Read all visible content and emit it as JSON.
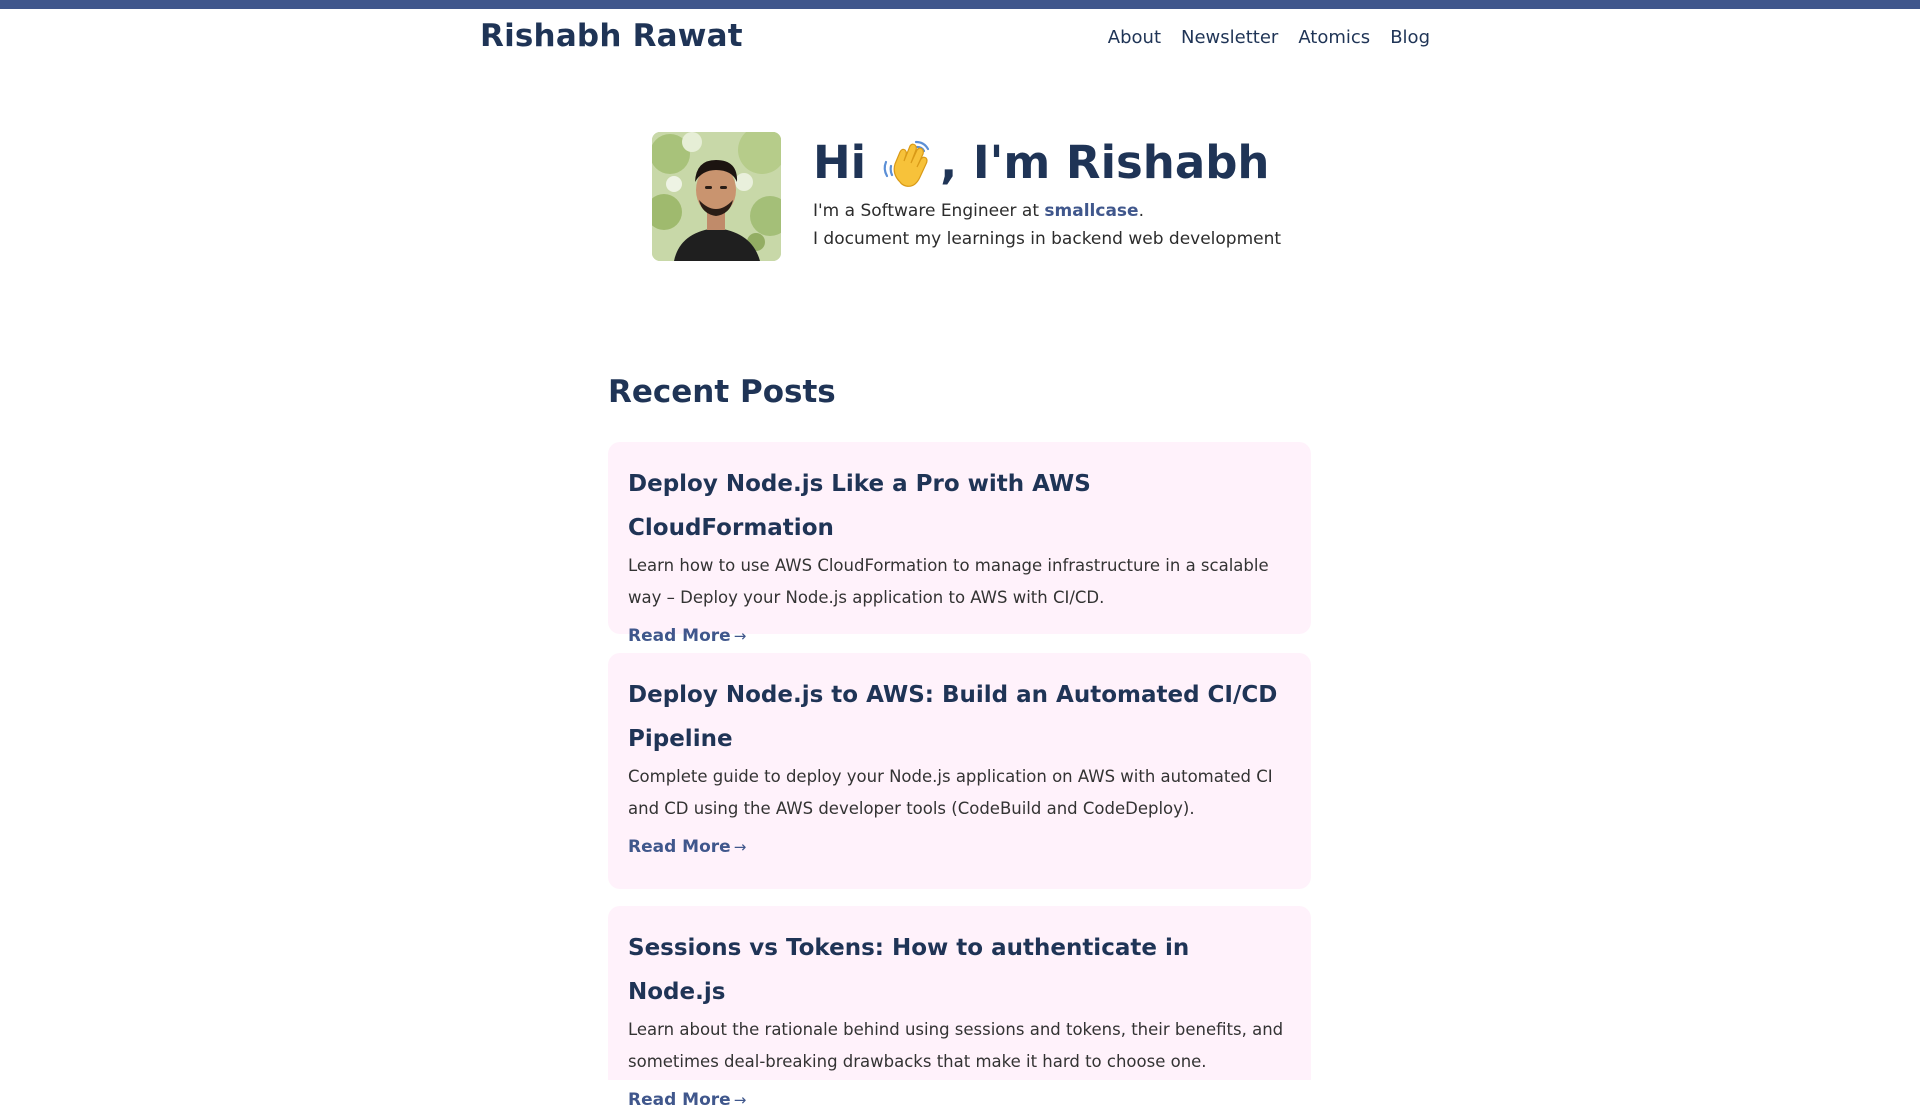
{
  "header": {
    "site_title": "Rishabh Rawat",
    "nav": [
      "About",
      "Newsletter",
      "Atomics",
      "Blog"
    ]
  },
  "hero": {
    "greeting_pre": "Hi",
    "greeting_post": ", I'm Rishabh",
    "wave_icon": "waving-hand-icon",
    "line1_pre": "I'm a Software Engineer at ",
    "line1_link": "smallcase",
    "line1_post": ".",
    "line2": "I document my learnings in backend web development"
  },
  "recent_posts": {
    "title": "Recent Posts",
    "read_more": "Read More",
    "arrow": "→",
    "posts": [
      {
        "title": "Deploy Node.js Like a Pro with AWS CloudFormation",
        "desc": "Learn how to use AWS CloudFormation to manage infrastructure in a scalable way – Deploy your Node.js application to AWS with CI/CD."
      },
      {
        "title": "Deploy Node.js to AWS: Build an Automated CI/CD Pipeline",
        "desc": "Complete guide to deploy your Node.js application on AWS with automated CI and CD using the AWS developer tools (CodeBuild and CodeDeploy)."
      },
      {
        "title": "Sessions vs Tokens: How to authenticate in Node.js",
        "desc": "Learn about the rationale behind using sessions and tokens, their benefits, and sometimes deal-breaking drawbacks that make it hard to choose one."
      }
    ]
  },
  "colors": {
    "top_bar": "#40578c",
    "heading": "#1f3456",
    "link": "#40578c",
    "card_bg": "#fff2fb"
  }
}
